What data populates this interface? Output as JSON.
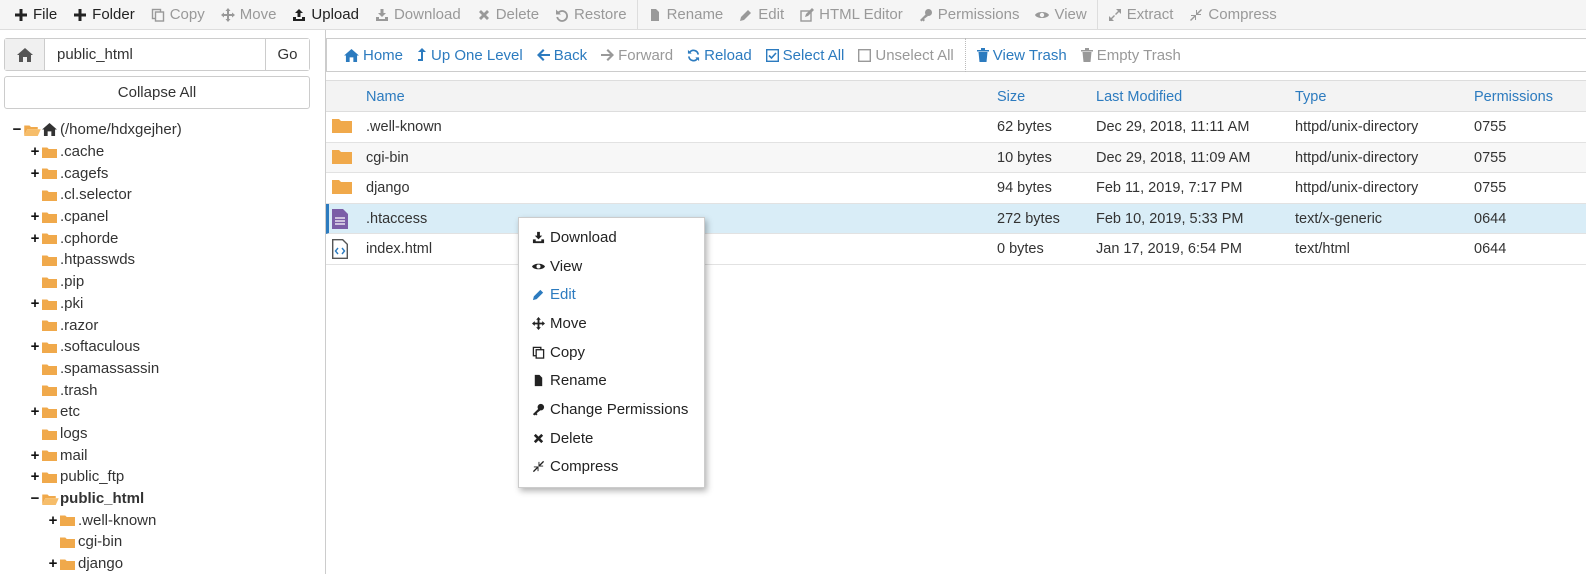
{
  "toolbar": {
    "file": "File",
    "folder": "Folder",
    "copy": "Copy",
    "move": "Move",
    "upload": "Upload",
    "download": "Download",
    "delete": "Delete",
    "restore": "Restore",
    "rename": "Rename",
    "edit": "Edit",
    "html_editor": "HTML Editor",
    "permissions": "Permissions",
    "view": "View",
    "extract": "Extract",
    "compress": "Compress"
  },
  "left": {
    "path_value": "public_html",
    "go_label": "Go",
    "collapse_label": "Collapse All",
    "tree": [
      {
        "label": "(/home/hdxgejher)",
        "toggle": "−",
        "level": 0,
        "home": true,
        "open": true
      },
      {
        "label": ".cache",
        "toggle": "+",
        "level": 1
      },
      {
        "label": ".cagefs",
        "toggle": "+",
        "level": 1
      },
      {
        "label": ".cl.selector",
        "toggle": "",
        "level": 1
      },
      {
        "label": ".cpanel",
        "toggle": "+",
        "level": 1
      },
      {
        "label": ".cphorde",
        "toggle": "+",
        "level": 1
      },
      {
        "label": ".htpasswds",
        "toggle": "",
        "level": 1
      },
      {
        "label": ".pip",
        "toggle": "",
        "level": 1
      },
      {
        "label": ".pki",
        "toggle": "+",
        "level": 1
      },
      {
        "label": ".razor",
        "toggle": "",
        "level": 1
      },
      {
        "label": ".softaculous",
        "toggle": "+",
        "level": 1
      },
      {
        "label": ".spamassassin",
        "toggle": "",
        "level": 1
      },
      {
        "label": ".trash",
        "toggle": "",
        "level": 1
      },
      {
        "label": "etc",
        "toggle": "+",
        "level": 1
      },
      {
        "label": "logs",
        "toggle": "",
        "level": 1
      },
      {
        "label": "mail",
        "toggle": "+",
        "level": 1
      },
      {
        "label": "public_ftp",
        "toggle": "+",
        "level": 1
      },
      {
        "label": "public_html",
        "toggle": "−",
        "level": 1,
        "bold": true,
        "open": true
      },
      {
        "label": ".well-known",
        "toggle": "+",
        "level": 2
      },
      {
        "label": "cgi-bin",
        "toggle": "",
        "level": 2
      },
      {
        "label": "django",
        "toggle": "+",
        "level": 2
      }
    ]
  },
  "nav": {
    "home": "Home",
    "up": "Up One Level",
    "back": "Back",
    "forward": "Forward",
    "reload": "Reload",
    "select_all": "Select All",
    "unselect_all": "Unselect All",
    "view_trash": "View Trash",
    "empty_trash": "Empty Trash"
  },
  "table": {
    "headers": {
      "name": "Name",
      "size": "Size",
      "modified": "Last Modified",
      "type": "Type",
      "perms": "Permissions"
    },
    "rows": [
      {
        "icon": "folder",
        "name": ".well-known",
        "size": "62 bytes",
        "modified": "Dec 29, 2018, 11:11 AM",
        "type": "httpd/unix-directory",
        "perms": "0755"
      },
      {
        "icon": "folder",
        "name": "cgi-bin",
        "size": "10 bytes",
        "modified": "Dec 29, 2018, 11:09 AM",
        "type": "httpd/unix-directory",
        "perms": "0755"
      },
      {
        "icon": "folder",
        "name": "django",
        "size": "94 bytes",
        "modified": "Feb 11, 2019, 7:17 PM",
        "type": "httpd/unix-directory",
        "perms": "0755"
      },
      {
        "icon": "text-file",
        "name": ".htaccess",
        "size": "272 bytes",
        "modified": "Feb 10, 2019, 5:33 PM",
        "type": "text/x-generic",
        "perms": "0644",
        "selected": true
      },
      {
        "icon": "code-file",
        "name": "index.html",
        "size": "0 bytes",
        "modified": "Jan 17, 2019, 6:54 PM",
        "type": "text/html",
        "perms": "0644"
      }
    ]
  },
  "context_menu": {
    "items": [
      {
        "icon": "download-icon",
        "label": "Download"
      },
      {
        "icon": "eye-icon",
        "label": "View"
      },
      {
        "icon": "pencil-icon",
        "label": "Edit",
        "highlight": true
      },
      {
        "icon": "move-icon",
        "label": "Move"
      },
      {
        "icon": "copy-icon",
        "label": "Copy"
      },
      {
        "icon": "file-icon",
        "label": "Rename"
      },
      {
        "icon": "key-icon",
        "label": "Change Permissions"
      },
      {
        "icon": "x-icon",
        "label": "Delete"
      },
      {
        "icon": "compress-icon",
        "label": "Compress"
      }
    ]
  },
  "colors": {
    "accent": "#2c7bbf",
    "folder": "#f0a94b",
    "selected_row": "#d9edf7"
  }
}
